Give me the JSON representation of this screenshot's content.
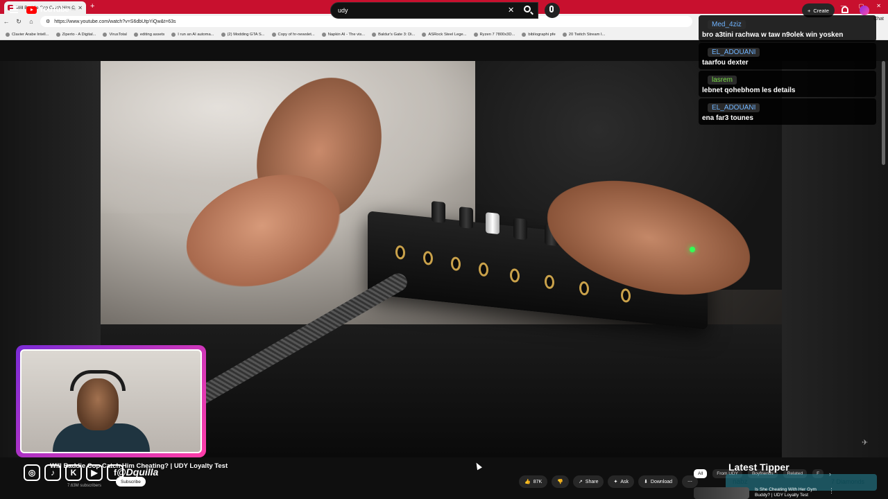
{
  "browser": {
    "tab_title": "Will Baddie Cop Catch Him Ch...",
    "url": "https://www.youtube.com/watch?v=S6dbUtpYiQw&t=63s",
    "chat_label": "Chat",
    "bookmarks": [
      "Clavier Arabe Intell...",
      "Ziperto - A Digital...",
      "VirusTotal",
      "editing assets",
      "I run an AI automa...",
      "(2) Modding GTA S...",
      "Copy of hr-newslet...",
      "Napkin AI - The vis...",
      "Baldur's Gate 3: Di...",
      "ASRock Steel Lege...",
      "Ryzen 7 7800x3D...",
      "bibliographi pfe",
      "20 Twitch Stream I..."
    ]
  },
  "youtube": {
    "logo_text": "YouTube",
    "logo_sup": "TN",
    "search_value": "udy",
    "create_label": "Create"
  },
  "chat": [
    {
      "user": "Med_4ziz",
      "text": "bro a3tini rachwa w taw n9olek win yosken",
      "color": "#6fb4ff"
    },
    {
      "user": "EL_ADOUANI",
      "text": "taarfou dexter",
      "color": "#6fb4ff"
    },
    {
      "user": "lasrem",
      "text": "lebnet qohebhom les details",
      "color": "#7ddf4a"
    },
    {
      "user": "EL_ADOUANI",
      "text": "ena far3 tounes",
      "color": "#6fb4ff"
    }
  ],
  "video": {
    "title": "Will Baddie Cop Catch Him Cheating? | UDY Loyalty Test",
    "subscribers": "7.63M subscribers",
    "subscribe_label": "Subscribe",
    "likes": "87K",
    "share_label": "Share",
    "ask_label": "Ask",
    "download_label": "Download"
  },
  "overlay": {
    "handle": "@Dquilla",
    "socials": [
      "instagram-icon",
      "tiktok-icon",
      "kick-icon",
      "youtube-icon",
      "facebook-icon"
    ],
    "latest_tipper_title": "Latest Tipper",
    "tipper_name": "nabz",
    "tipper_amount": "7 Diamonds"
  },
  "related": {
    "chips": [
      "All",
      "From UDY",
      "Boyfriends",
      "Related",
      "F"
    ],
    "item_title": "Is She Cheating With Her Gym Buddy? | UDY Loyalty Test"
  }
}
